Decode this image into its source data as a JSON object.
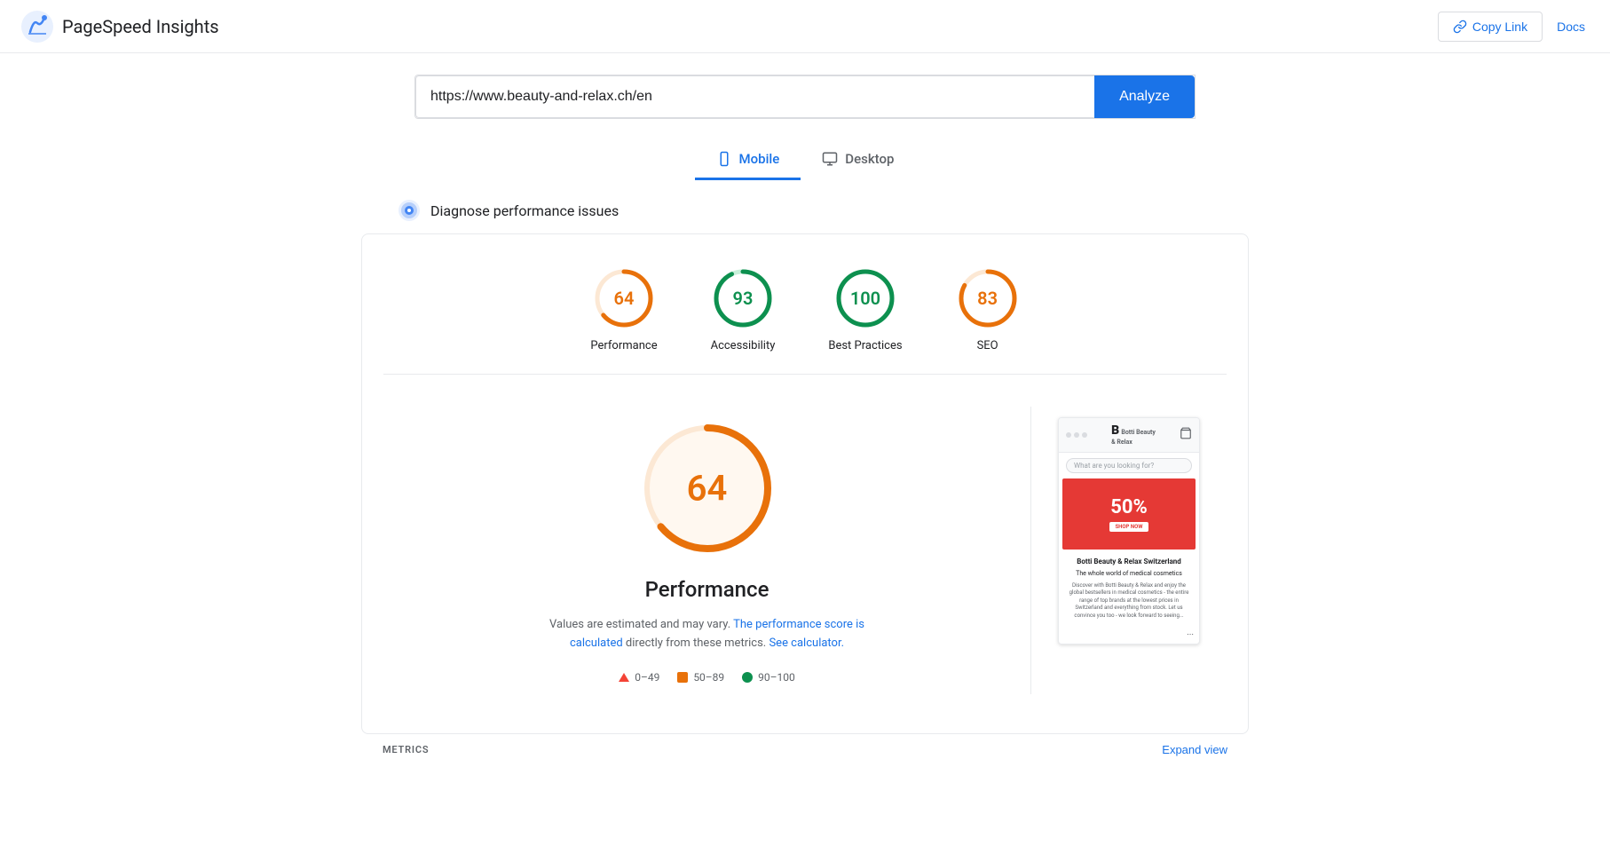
{
  "header": {
    "app_title": "PageSpeed Insights",
    "copy_link_label": "Copy Link",
    "docs_label": "Docs"
  },
  "url_bar": {
    "value": "https://www.beauty-and-relax.ch/en",
    "placeholder": "Enter web page URL",
    "analyze_label": "Analyze"
  },
  "tabs": [
    {
      "id": "mobile",
      "label": "Mobile",
      "active": true
    },
    {
      "id": "desktop",
      "label": "Desktop",
      "active": false
    }
  ],
  "diagnose": {
    "text": "Diagnose performance issues"
  },
  "scores": [
    {
      "id": "performance",
      "value": "64",
      "label": "Performance",
      "color": "#e8710a",
      "track_color": "#fce8d4",
      "score_num": 64
    },
    {
      "id": "accessibility",
      "value": "93",
      "label": "Accessibility",
      "color": "#0d904f",
      "track_color": "#c8f0da",
      "score_num": 93
    },
    {
      "id": "best-practices",
      "value": "100",
      "label": "Best Practices",
      "color": "#0d904f",
      "track_color": "#c8f0da",
      "score_num": 100
    },
    {
      "id": "seo",
      "value": "83",
      "label": "SEO",
      "color": "#e8710a",
      "track_color": "#fce8d4",
      "score_num": 83
    }
  ],
  "performance_detail": {
    "score": "64",
    "title": "Performance",
    "note_static": "Values are estimated and may vary.",
    "note_link1": "The performance score is calculated",
    "note_link2": "directly from these metrics.",
    "note_link3": "See calculator.",
    "color": "#e8710a"
  },
  "legend": [
    {
      "type": "triangle",
      "range": "0–49"
    },
    {
      "type": "square",
      "range": "50–89"
    },
    {
      "type": "circle",
      "range": "90–100",
      "color": "#0d904f"
    }
  ],
  "phone_mockup": {
    "brand": "Botti Beauty & Relax Switzerland",
    "tagline": "The whole world of medical cosmetics",
    "desc": "Discover with Botti Beauty & Relax and enjoy the global bestsellers in medical cosmetics - the entire range of top brands at the lowest prices in Switzerland and everything from stock. Let us convince you too - we look forward to seeing...",
    "banner_text": "50%",
    "shop_now": "SHOP NOW",
    "search_placeholder": "What are you looking for?"
  },
  "footer": {
    "metrics_label": "METRICS",
    "expand_label": "Expand view"
  }
}
